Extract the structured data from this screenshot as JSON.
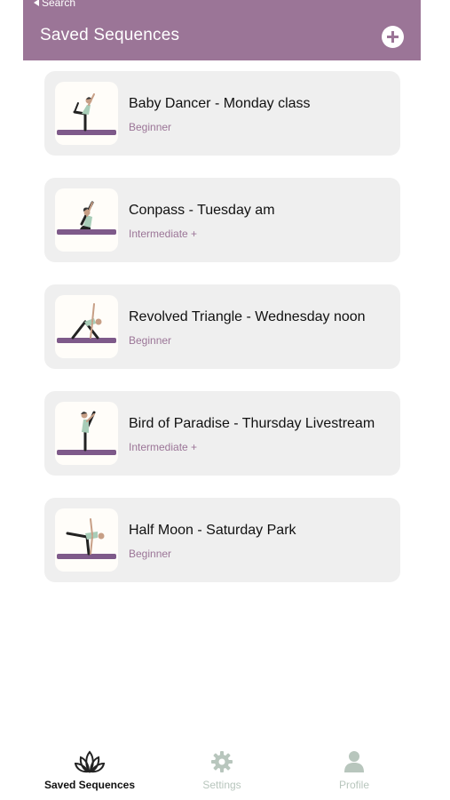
{
  "nav": {
    "back_label": "Search",
    "title": "Saved Sequences"
  },
  "colors": {
    "header": "#9b7597",
    "mat": "#7e5a8a",
    "top": "#a8cdb8",
    "pants": "#222222",
    "inactive_tab": "#b8c6bd"
  },
  "sequences": [
    {
      "title": "Baby Dancer - Monday class",
      "level": "Beginner",
      "pose_icon": "dancer-pose-icon"
    },
    {
      "title": "Conpass - Tuesday am",
      "level": "Intermediate +",
      "pose_icon": "compass-pose-icon"
    },
    {
      "title": "Revolved Triangle - Wednesday noon",
      "level": "Beginner",
      "pose_icon": "triangle-pose-icon"
    },
    {
      "title": "Bird of Paradise - Thursday Livestream",
      "level": "Intermediate +",
      "pose_icon": "bird-of-paradise-pose-icon"
    },
    {
      "title": "Half Moon - Saturday Park",
      "level": "Beginner",
      "pose_icon": "half-moon-pose-icon"
    }
  ],
  "tabs": [
    {
      "label": "Saved Sequences",
      "icon": "lotus-icon",
      "active": true
    },
    {
      "label": "Settings",
      "icon": "gear-icon",
      "active": false
    },
    {
      "label": "Profile",
      "icon": "person-icon",
      "active": false
    }
  ]
}
